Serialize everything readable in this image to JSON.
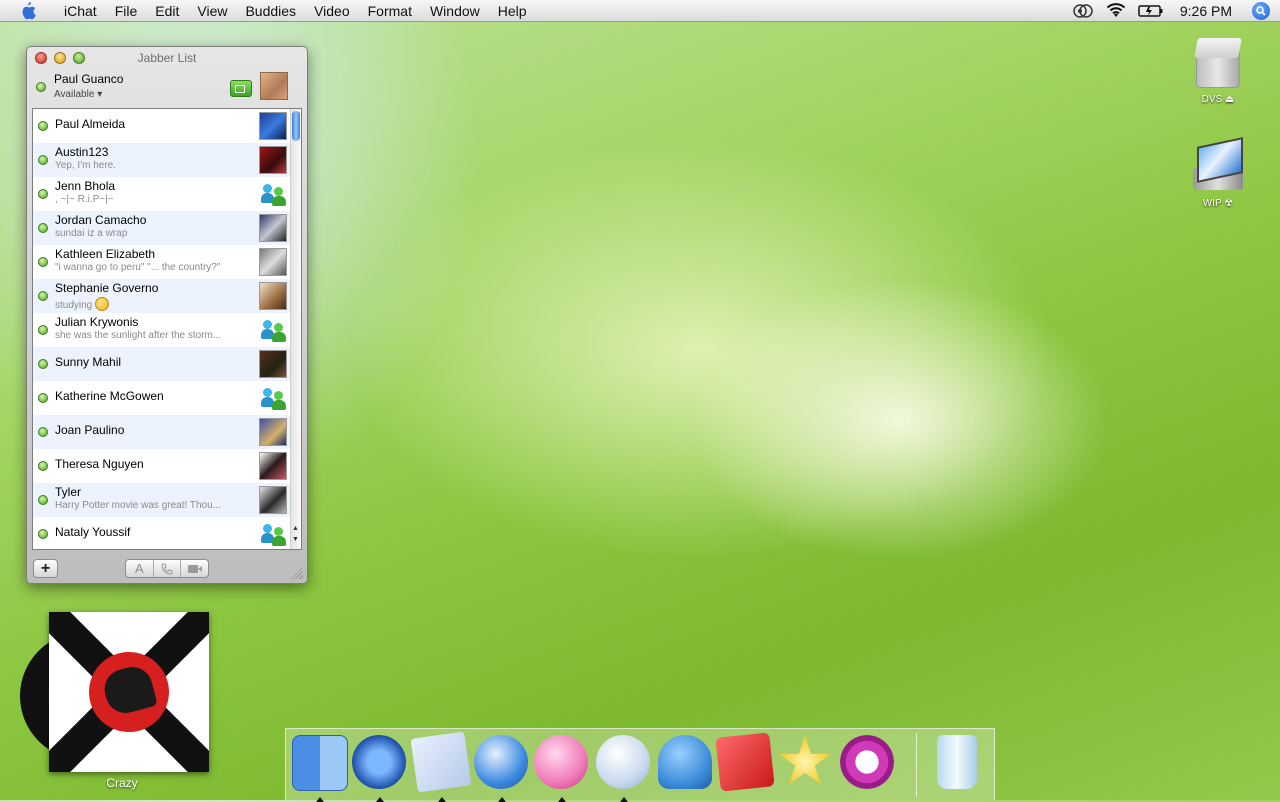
{
  "menubar": {
    "app": "iChat",
    "menus": [
      "File",
      "Edit",
      "View",
      "Buddies",
      "Video",
      "Format",
      "Window",
      "Help"
    ],
    "clock": "9:26 PM"
  },
  "window": {
    "title": "Jabber List",
    "me": {
      "name": "Paul Guanco",
      "status": "Available"
    },
    "buddies": [
      {
        "name": "Paul Almeida",
        "message": ""
      },
      {
        "name": "Austin123",
        "message": "Yep, I'm here."
      },
      {
        "name": "Jenn Bhola",
        "message": ",        ~|~ R.i.P~|~"
      },
      {
        "name": "Jordan Camacho",
        "message": "sundai iz a wrap"
      },
      {
        "name": "Kathleen Elizabeth",
        "message": "\"i wanna go to peru\"   \"... the country?\""
      },
      {
        "name": "Stephanie Governo",
        "message": "studying"
      },
      {
        "name": "Julian Krywonis",
        "message": "she was the sunlight after the storm..."
      },
      {
        "name": "Sunny Mahil",
        "message": ""
      },
      {
        "name": "Katherine McGowen",
        "message": ""
      },
      {
        "name": "Joan Paulino",
        "message": ""
      },
      {
        "name": "Theresa Nguyen",
        "message": ""
      },
      {
        "name": "Tyler",
        "message": "Harry Potter movie was great! Thou..."
      },
      {
        "name": "Nataly Youssif",
        "message": ""
      }
    ],
    "buttons": {
      "add": "+",
      "text": "A"
    }
  },
  "desktop": {
    "icons": [
      {
        "label": "DVS ⏏"
      },
      {
        "label": "WIP ☢"
      }
    ],
    "album": {
      "title": "Crazy"
    }
  },
  "dock": {
    "apps": [
      "finder-icon",
      "dashboard-icon",
      "preview-icon",
      "safari-icon",
      "ichat-icon",
      "itunes-icon",
      "adium-icon",
      "textmate-icon",
      "star-icon",
      "quicktime-icon",
      "trash-icon"
    ]
  }
}
